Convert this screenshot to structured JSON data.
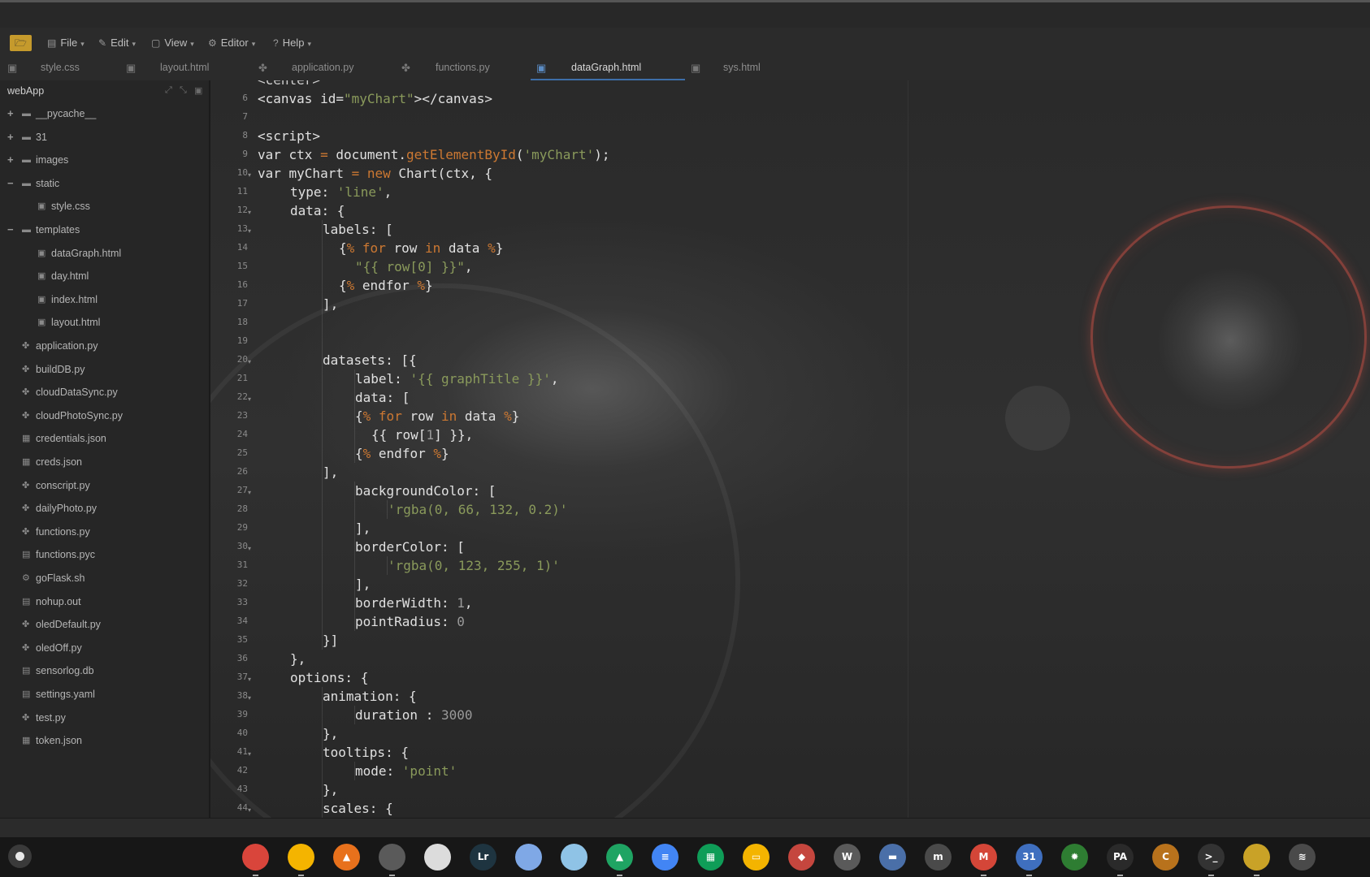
{
  "menubar": {
    "items": [
      {
        "label": "File",
        "icon": "file-icon"
      },
      {
        "label": "Edit",
        "icon": "edit-icon"
      },
      {
        "label": "View",
        "icon": "view-icon"
      },
      {
        "label": "Editor",
        "icon": "gear-icon"
      },
      {
        "label": "Help",
        "icon": "help-icon"
      }
    ]
  },
  "tabs": [
    {
      "label": "style.css",
      "icon": "css-file-icon",
      "active": false
    },
    {
      "label": "layout.html",
      "icon": "html-file-icon",
      "active": false
    },
    {
      "label": "application.py",
      "icon": "python-file-icon",
      "active": false
    },
    {
      "label": "functions.py",
      "icon": "python-file-icon",
      "active": false
    },
    {
      "label": "dataGraph.html",
      "icon": "html-file-icon",
      "active": true
    },
    {
      "label": "sys.html",
      "icon": "html-file-icon",
      "active": false
    }
  ],
  "sidebar": {
    "project_name": "webApp",
    "tree": [
      {
        "label": "__pycache__",
        "type": "folder",
        "expander": "+"
      },
      {
        "label": "31",
        "type": "folder",
        "expander": "+"
      },
      {
        "label": "images",
        "type": "folder",
        "expander": "+"
      },
      {
        "label": "static",
        "type": "folder",
        "expander": "−"
      },
      {
        "label": "style.css",
        "type": "css-file"
      },
      {
        "label": "templates",
        "type": "folder",
        "expander": "−"
      },
      {
        "label": "dataGraph.html",
        "type": "html-file"
      },
      {
        "label": "day.html",
        "type": "html-file"
      },
      {
        "label": "index.html",
        "type": "html-file"
      },
      {
        "label": "layout.html",
        "type": "html-file"
      },
      {
        "label": "application.py",
        "type": "python-file"
      },
      {
        "label": "buildDB.py",
        "type": "python-file"
      },
      {
        "label": "cloudDataSync.py",
        "type": "python-file"
      },
      {
        "label": "cloudPhotoSync.py",
        "type": "python-file"
      },
      {
        "label": "credentials.json",
        "type": "json-file"
      },
      {
        "label": "creds.json",
        "type": "json-file"
      },
      {
        "label": "conscript.py",
        "type": "python-file"
      },
      {
        "label": "dailyPhoto.py",
        "type": "python-file"
      },
      {
        "label": "functions.py",
        "type": "python-file"
      },
      {
        "label": "functions.pyc",
        "type": "file"
      },
      {
        "label": "goFlask.sh",
        "type": "shell-file"
      },
      {
        "label": "nohup.out",
        "type": "file"
      },
      {
        "label": "oledDefault.py",
        "type": "python-file"
      },
      {
        "label": "oledOff.py",
        "type": "python-file"
      },
      {
        "label": "sensorlog.db",
        "type": "file"
      },
      {
        "label": "settings.yaml",
        "type": "file"
      },
      {
        "label": "test.py",
        "type": "python-file"
      },
      {
        "label": "token.json",
        "type": "json-file"
      }
    ]
  },
  "editor": {
    "partial_top_line": "<center>",
    "lines": [
      {
        "n": "6",
        "fold": false,
        "indent": 0,
        "tokens": [
          [
            "p",
            "<canvas id="
          ],
          [
            "s",
            "\"myChart\""
          ],
          [
            "p",
            "></canvas>"
          ]
        ]
      },
      {
        "n": "7",
        "fold": false,
        "indent": 0,
        "tokens": []
      },
      {
        "n": "8",
        "fold": false,
        "indent": 0,
        "tokens": [
          [
            "p",
            "<script>"
          ]
        ]
      },
      {
        "n": "9",
        "fold": false,
        "indent": 0,
        "tokens": [
          [
            "p",
            "var ctx "
          ],
          [
            "k",
            "="
          ],
          [
            "p",
            " document."
          ],
          [
            "f",
            "getElementById"
          ],
          [
            "p",
            "("
          ],
          [
            "s",
            "'myChart'"
          ],
          [
            "p",
            ");"
          ]
        ]
      },
      {
        "n": "10",
        "fold": true,
        "indent": 0,
        "tokens": [
          [
            "p",
            "var myChart "
          ],
          [
            "k",
            "="
          ],
          [
            "p",
            " "
          ],
          [
            "k",
            "new"
          ],
          [
            "p",
            " Chart(ctx, {"
          ]
        ]
      },
      {
        "n": "11",
        "fold": false,
        "indent": 1,
        "tokens": [
          [
            "p",
            "type: "
          ],
          [
            "s",
            "'line'"
          ],
          [
            "p",
            ","
          ]
        ]
      },
      {
        "n": "12",
        "fold": true,
        "indent": 1,
        "tokens": [
          [
            "p",
            "data: {"
          ]
        ]
      },
      {
        "n": "13",
        "fold": true,
        "indent": 2,
        "tokens": [
          [
            "p",
            "labels: ["
          ]
        ]
      },
      {
        "n": "14",
        "fold": false,
        "indent": 2,
        "extra": "  ",
        "tokens": [
          [
            "p",
            "{"
          ],
          [
            "k",
            "%"
          ],
          [
            "p",
            " "
          ],
          [
            "k",
            "for"
          ],
          [
            "p",
            " row "
          ],
          [
            "k",
            "in"
          ],
          [
            "p",
            " data "
          ],
          [
            "k",
            "%"
          ],
          [
            "p",
            "}"
          ]
        ]
      },
      {
        "n": "15",
        "fold": false,
        "indent": 2,
        "extra": "    ",
        "tokens": [
          [
            "s",
            "\"{{ row[0] }}\""
          ],
          [
            "p",
            ","
          ]
        ]
      },
      {
        "n": "16",
        "fold": false,
        "indent": 2,
        "extra": "  ",
        "tokens": [
          [
            "p",
            "{"
          ],
          [
            "k",
            "%"
          ],
          [
            "p",
            " endfor "
          ],
          [
            "k",
            "%"
          ],
          [
            "p",
            "}"
          ]
        ]
      },
      {
        "n": "17",
        "fold": false,
        "indent": 2,
        "tokens": [
          [
            "p",
            "],"
          ]
        ]
      },
      {
        "n": "18",
        "fold": false,
        "indent": 2,
        "tokens": []
      },
      {
        "n": "19",
        "fold": false,
        "indent": 2,
        "tokens": []
      },
      {
        "n": "20",
        "fold": true,
        "indent": 2,
        "tokens": [
          [
            "p",
            "datasets: [{"
          ]
        ]
      },
      {
        "n": "21",
        "fold": false,
        "indent": 3,
        "tokens": [
          [
            "p",
            "label: "
          ],
          [
            "s",
            "'{{ graphTitle }}'"
          ],
          [
            "p",
            ","
          ]
        ]
      },
      {
        "n": "22",
        "fold": true,
        "indent": 3,
        "tokens": [
          [
            "p",
            "data: ["
          ]
        ]
      },
      {
        "n": "23",
        "fold": false,
        "indent": 3,
        "tokens": [
          [
            "p",
            "{"
          ],
          [
            "k",
            "%"
          ],
          [
            "p",
            " "
          ],
          [
            "k",
            "for"
          ],
          [
            "p",
            " row "
          ],
          [
            "k",
            "in"
          ],
          [
            "p",
            " data "
          ],
          [
            "k",
            "%"
          ],
          [
            "p",
            "}"
          ]
        ]
      },
      {
        "n": "24",
        "fold": false,
        "indent": 3,
        "extra": "  ",
        "tokens": [
          [
            "p",
            "{{ row["
          ],
          [
            "n",
            "1"
          ],
          [
            "p",
            "] }},"
          ]
        ]
      },
      {
        "n": "25",
        "fold": false,
        "indent": 3,
        "tokens": [
          [
            "p",
            "{"
          ],
          [
            "k",
            "%"
          ],
          [
            "p",
            " endfor "
          ],
          [
            "k",
            "%"
          ],
          [
            "p",
            "}"
          ]
        ]
      },
      {
        "n": "26",
        "fold": false,
        "indent": 2,
        "tokens": [
          [
            "p",
            "],"
          ]
        ]
      },
      {
        "n": "27",
        "fold": true,
        "indent": 3,
        "tokens": [
          [
            "p",
            "backgroundColor: ["
          ]
        ]
      },
      {
        "n": "28",
        "fold": false,
        "indent": 4,
        "tokens": [
          [
            "s",
            "'rgba(0, 66, 132, 0.2)'"
          ]
        ]
      },
      {
        "n": "29",
        "fold": false,
        "indent": 3,
        "tokens": [
          [
            "p",
            "],"
          ]
        ]
      },
      {
        "n": "30",
        "fold": true,
        "indent": 3,
        "tokens": [
          [
            "p",
            "borderColor: ["
          ]
        ]
      },
      {
        "n": "31",
        "fold": false,
        "indent": 4,
        "tokens": [
          [
            "s",
            "'rgba(0, 123, 255, 1)'"
          ]
        ]
      },
      {
        "n": "32",
        "fold": false,
        "indent": 3,
        "tokens": [
          [
            "p",
            "],"
          ]
        ]
      },
      {
        "n": "33",
        "fold": false,
        "indent": 3,
        "tokens": [
          [
            "p",
            "borderWidth: "
          ],
          [
            "n",
            "1"
          ],
          [
            "p",
            ","
          ]
        ]
      },
      {
        "n": "34",
        "fold": false,
        "indent": 3,
        "tokens": [
          [
            "p",
            "pointRadius: "
          ],
          [
            "n",
            "0"
          ]
        ]
      },
      {
        "n": "35",
        "fold": false,
        "indent": 2,
        "tokens": [
          [
            "p",
            "}]"
          ]
        ]
      },
      {
        "n": "36",
        "fold": false,
        "indent": 1,
        "tokens": [
          [
            "p",
            "},"
          ]
        ]
      },
      {
        "n": "37",
        "fold": true,
        "indent": 1,
        "tokens": [
          [
            "p",
            "options: {"
          ]
        ]
      },
      {
        "n": "38",
        "fold": true,
        "indent": 2,
        "tokens": [
          [
            "p",
            "animation: {"
          ]
        ]
      },
      {
        "n": "39",
        "fold": false,
        "indent": 3,
        "tokens": [
          [
            "p",
            "duration : "
          ],
          [
            "n",
            "3000"
          ]
        ]
      },
      {
        "n": "40",
        "fold": false,
        "indent": 2,
        "tokens": [
          [
            "p",
            "},"
          ]
        ]
      },
      {
        "n": "41",
        "fold": true,
        "indent": 2,
        "tokens": [
          [
            "p",
            "tooltips: {"
          ]
        ]
      },
      {
        "n": "42",
        "fold": false,
        "indent": 3,
        "tokens": [
          [
            "p",
            "mode: "
          ],
          [
            "s",
            "'point'"
          ]
        ]
      },
      {
        "n": "43",
        "fold": false,
        "indent": 2,
        "tokens": [
          [
            "p",
            "},"
          ]
        ]
      },
      {
        "n": "44",
        "fold": true,
        "indent": 2,
        "tokens": [
          [
            "p",
            "scales: {"
          ]
        ]
      }
    ]
  },
  "dock": {
    "apps": [
      {
        "name": "chrome-icon",
        "glyph": "",
        "color": "#d9453b",
        "running": true
      },
      {
        "name": "photos-icon",
        "glyph": "",
        "color": "#f4b400",
        "running": true
      },
      {
        "name": "gallery-icon",
        "glyph": "▲",
        "color": "#e8711c",
        "running": false
      },
      {
        "name": "gimp-icon",
        "glyph": "",
        "color": "#5a5a5a",
        "running": true
      },
      {
        "name": "inkscape-icon",
        "glyph": "",
        "color": "#dcdcdc",
        "running": false
      },
      {
        "name": "lightroom-icon",
        "glyph": "Lr",
        "color": "#1e3440",
        "running": false
      },
      {
        "name": "paint-icon",
        "glyph": "",
        "color": "#7fa8e6",
        "running": false
      },
      {
        "name": "shield-icon",
        "glyph": "",
        "color": "#8fc3e6",
        "running": false
      },
      {
        "name": "drive-icon",
        "glyph": "▲",
        "color": "#1fa463",
        "running": true
      },
      {
        "name": "docs-icon",
        "glyph": "≡",
        "color": "#4285f4",
        "running": false
      },
      {
        "name": "sheets-icon",
        "glyph": "▦",
        "color": "#0f9d58",
        "running": false
      },
      {
        "name": "slides-icon",
        "glyph": "▭",
        "color": "#f4b400",
        "running": false
      },
      {
        "name": "document-viewer-icon",
        "glyph": "◆",
        "color": "#c5463e",
        "running": false
      },
      {
        "name": "wordpress-icon",
        "glyph": "W",
        "color": "#5a5a5a",
        "running": false
      },
      {
        "name": "files-icon",
        "glyph": "▬",
        "color": "#4a6fa8",
        "running": false
      },
      {
        "name": "mastodon-icon",
        "glyph": "m",
        "color": "#4a4a4a",
        "running": false
      },
      {
        "name": "gmail-icon",
        "glyph": "M",
        "color": "#d44638",
        "running": true
      },
      {
        "name": "calendar-icon",
        "glyph": "31",
        "color": "#3f6fbf",
        "running": true
      },
      {
        "name": "android-settings-icon",
        "glyph": "✹",
        "color": "#2e7d32",
        "running": false
      },
      {
        "name": "codepad-icon",
        "glyph": "PA",
        "color": "#2a2a2a",
        "running": true
      },
      {
        "name": "caret-editor-icon",
        "glyph": "C",
        "color": "#b8721c",
        "running": false
      },
      {
        "name": "terminal-icon",
        "glyph": ">_",
        "color": "#333333",
        "running": true
      },
      {
        "name": "keep-icon",
        "glyph": "",
        "color": "#c9a227",
        "running": true
      },
      {
        "name": "database-icon",
        "glyph": "≋",
        "color": "#4a4a4a",
        "running": false
      }
    ]
  }
}
